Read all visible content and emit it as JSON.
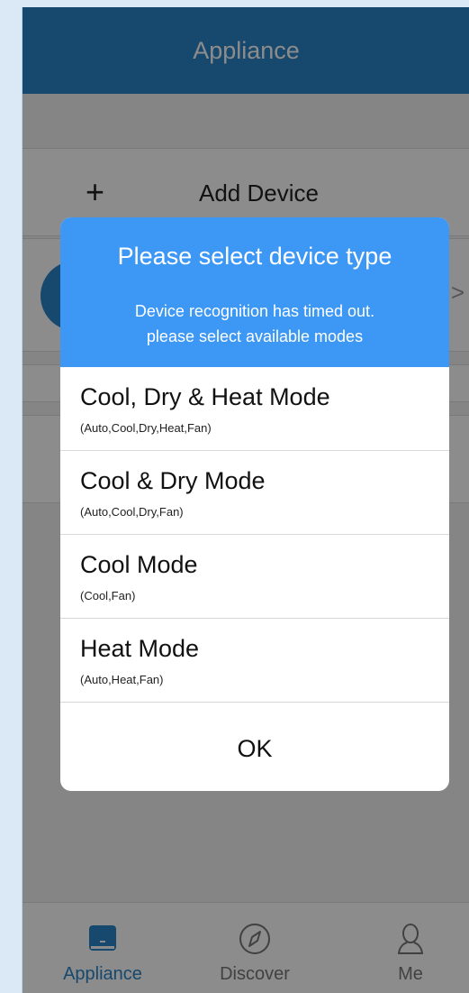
{
  "header": {
    "title": "Appliance"
  },
  "add_device": {
    "plus": "+",
    "label": "Add Device"
  },
  "device_row": {
    "chevron": ">"
  },
  "dialog": {
    "title": "Please select device type",
    "message_line1": "Device recognition has timed out.",
    "message_line2": "please select available modes",
    "options": [
      {
        "name": "Cool, Dry & Heat Mode",
        "modes": "(Auto,Cool,Dry,Heat,Fan)"
      },
      {
        "name": "Cool & Dry Mode",
        "modes": "(Auto,Cool,Dry,Fan)"
      },
      {
        "name": "Cool Mode",
        "modes": "(Cool,Fan)"
      },
      {
        "name": "Heat Mode",
        "modes": "(Auto,Heat,Fan)"
      }
    ],
    "ok_label": "OK"
  },
  "tabs": [
    {
      "label": "Appliance",
      "icon": "appliance-icon",
      "active": true
    },
    {
      "label": "Discover",
      "icon": "compass-icon",
      "active": false
    },
    {
      "label": "Me",
      "icon": "person-icon",
      "active": false
    }
  ],
  "colors": {
    "header": "#2a83c6",
    "dialog_header": "#3d97f4",
    "active_tab": "#2a83c6"
  }
}
